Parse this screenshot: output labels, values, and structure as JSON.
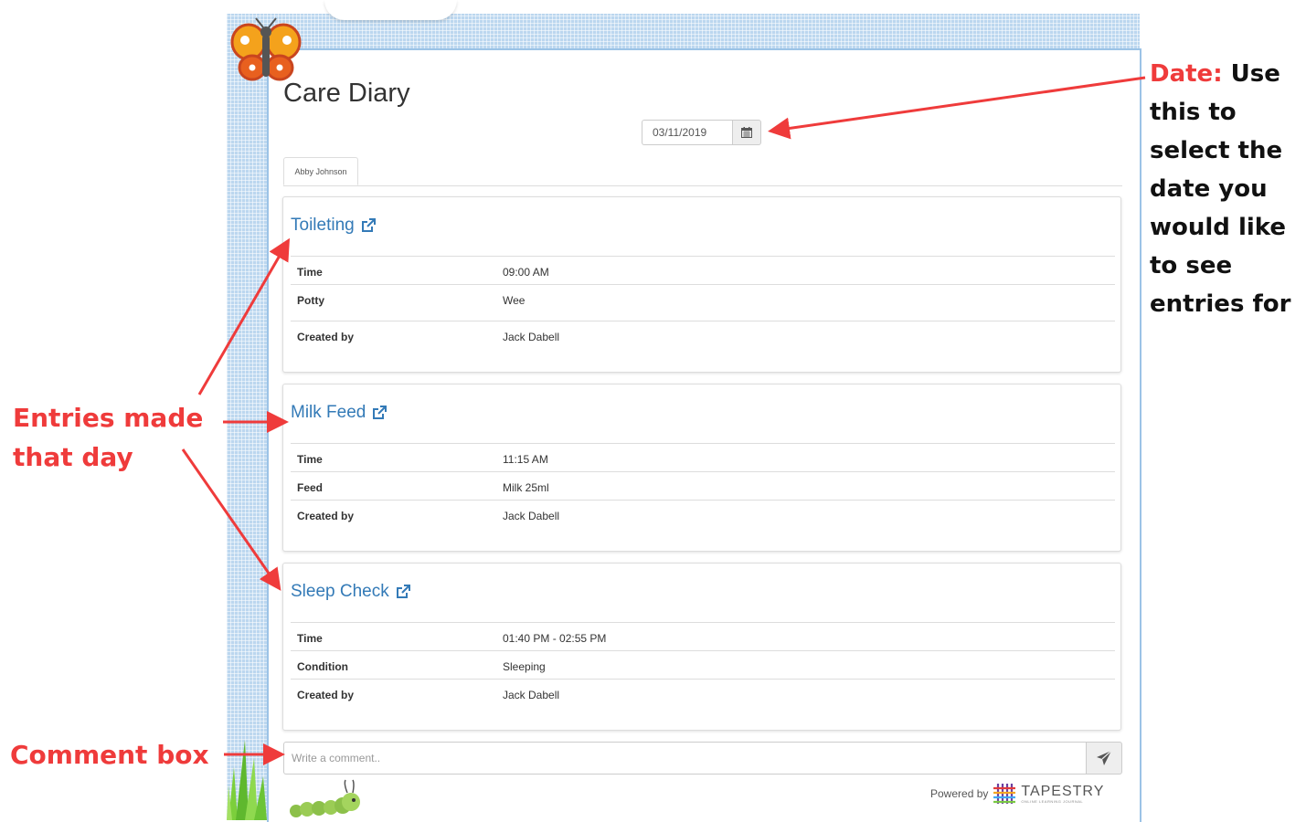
{
  "page": {
    "title": "Care Diary"
  },
  "date_picker": {
    "value": "03/11/2019",
    "icon": "calendar-icon"
  },
  "tabs": [
    {
      "label": "Abby Johnson",
      "active": true
    }
  ],
  "entries": [
    {
      "title": "Toileting",
      "rows": [
        {
          "label": "Time",
          "value": "09:00 AM"
        },
        {
          "label": "Potty",
          "value": "Wee"
        },
        {
          "label": "Created by",
          "value": "Jack Dabell"
        }
      ]
    },
    {
      "title": "Milk Feed",
      "rows": [
        {
          "label": "Time",
          "value": "11:15 AM"
        },
        {
          "label": "Feed",
          "value": "Milk 25ml"
        },
        {
          "label": "Created by",
          "value": "Jack Dabell"
        }
      ]
    },
    {
      "title": "Sleep Check",
      "rows": [
        {
          "label": "Time",
          "value": "01:40 PM - 02:55 PM"
        },
        {
          "label": "Condition",
          "value": "Sleeping"
        },
        {
          "label": "Created by",
          "value": "Jack Dabell"
        }
      ]
    }
  ],
  "comment": {
    "placeholder": "Write a comment..",
    "send_icon": "paper-plane-icon"
  },
  "footer": {
    "powered_by": "Powered by",
    "brand": "TAPESTRY",
    "brand_tagline": "ONLINE LEARNING JOURNAL"
  },
  "annotations": {
    "date_label": "Date:",
    "date_text": "Use this to select the date you would like to see entries for",
    "entries_text": "Entries made that day",
    "comment_text": "Comment box"
  },
  "colors": {
    "link": "#337ab7",
    "annotation_red": "#ef3b3b",
    "frame_blue": "#bcd7ef"
  }
}
